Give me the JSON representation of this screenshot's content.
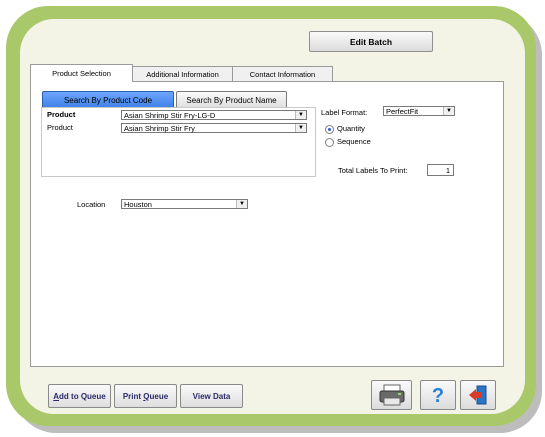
{
  "header": {
    "edit_batch_label": "Edit Batch"
  },
  "tabs": [
    {
      "label": "Product Selection"
    },
    {
      "label": "Additional Information"
    },
    {
      "label": "Contact Information"
    }
  ],
  "search": {
    "by_code_label": "Search By Product Code",
    "by_name_label": "Search By Product Name"
  },
  "products": [
    {
      "label": "Product",
      "value": "Asian Shrimp Stir Fry-LG-D"
    },
    {
      "label": "Product",
      "value": "Asian Shrimp Stir Fry"
    }
  ],
  "label_format": {
    "label": "Label Format:",
    "value": "PerfectFit"
  },
  "mode": {
    "quantity_label": "Quantity",
    "sequence_label": "Sequence",
    "selected": "Quantity"
  },
  "total_labels": {
    "label": "Total Labels To Print:",
    "value": "1"
  },
  "location": {
    "label": "Location",
    "value": "Houston"
  },
  "footer": {
    "add_to_queue_prefix": "A",
    "add_to_queue_rest": "dd to Queue",
    "print_queue_prefix": "Print ",
    "print_queue_u": "Q",
    "print_queue_rest": "ueue",
    "view_data_label": "View Data"
  },
  "icons": [
    "printer-icon",
    "help-icon",
    "exit-icon"
  ],
  "colors": {
    "frame": "#a8c86a",
    "panel": "#f4f4e6",
    "accent": "#3f7fe6"
  }
}
